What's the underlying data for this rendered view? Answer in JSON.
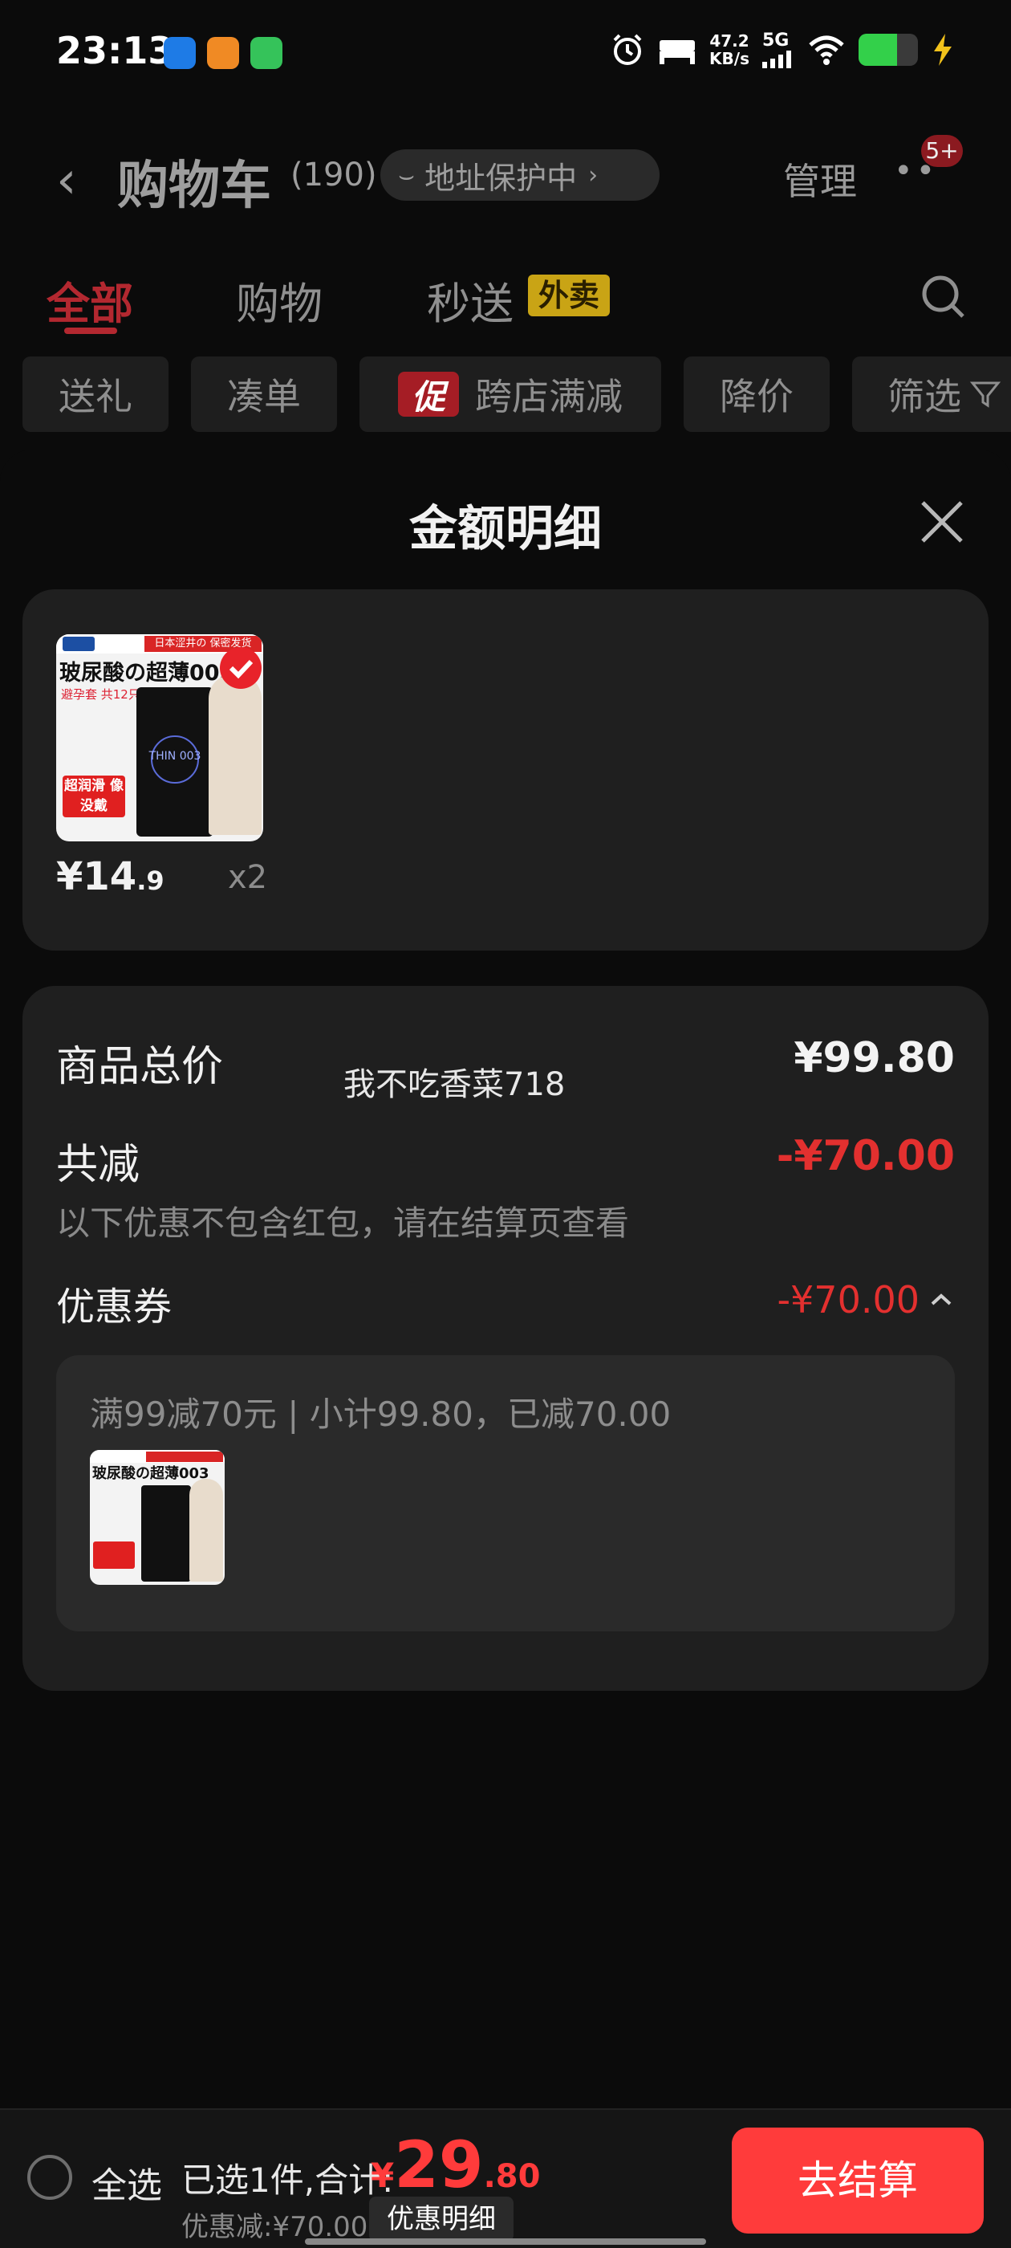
{
  "status_bar": {
    "time": "23:13",
    "net_speed_value": "47.2",
    "net_speed_unit": "KB/s",
    "signal_label": "5G",
    "battery_percent": 65,
    "icons": [
      "alarm-icon",
      "bed-icon",
      "signal-icon",
      "wifi-icon",
      "battery-icon",
      "charging-icon"
    ]
  },
  "header": {
    "title": "购物车",
    "count": "(190)",
    "address_pill": "地址保护中",
    "manage": "管理",
    "more_badge": "5+"
  },
  "tabs": {
    "all": "全部",
    "shopping": "购物",
    "instant": "秒送",
    "takeaway_badge": "外卖",
    "active": "全部"
  },
  "filters": {
    "gift": "送礼",
    "combine": "凑单",
    "promo_tag": "促",
    "cross_store": "跨店满减",
    "price_drop": "降价",
    "filter": "筛选"
  },
  "sheet": {
    "title": "金额明细",
    "product": {
      "price_main": "¥14",
      "price_decimal": ".9",
      "quantity": "x2",
      "image_banner": "日本涩井の 保密发货",
      "image_title": "玻尿酸の超薄003",
      "image_sub": "避孕套 共12只",
      "image_tag": "超润滑 像没戴",
      "image_model": "THIN 003"
    },
    "summary": {
      "total_label": "商品总价",
      "total_value": "¥99.80",
      "watermark": "我不吃香菜718",
      "reduce_label": "共减",
      "reduce_value": "-¥70.00",
      "reduce_note": "以下优惠不包含红包，请在结算页查看",
      "coupon_label": "优惠券",
      "coupon_value": "-¥70.00",
      "coupon_detail": "满99减70元 | 小计99.80，已减70.00"
    }
  },
  "bottom_bar": {
    "select_all": "全选",
    "selected_summary": "已选1件,合计:",
    "total_currency": "¥",
    "total_int": "29",
    "total_dec": ".80",
    "discount": "优惠减:¥70.00",
    "detail_button": "优惠明细",
    "checkout_button": "去结算"
  },
  "colors": {
    "accent_red": "#ff3b3b",
    "tab_red": "#b32830",
    "card_bg": "#1f1f1f",
    "takeaway_yellow": "#c9a415"
  }
}
